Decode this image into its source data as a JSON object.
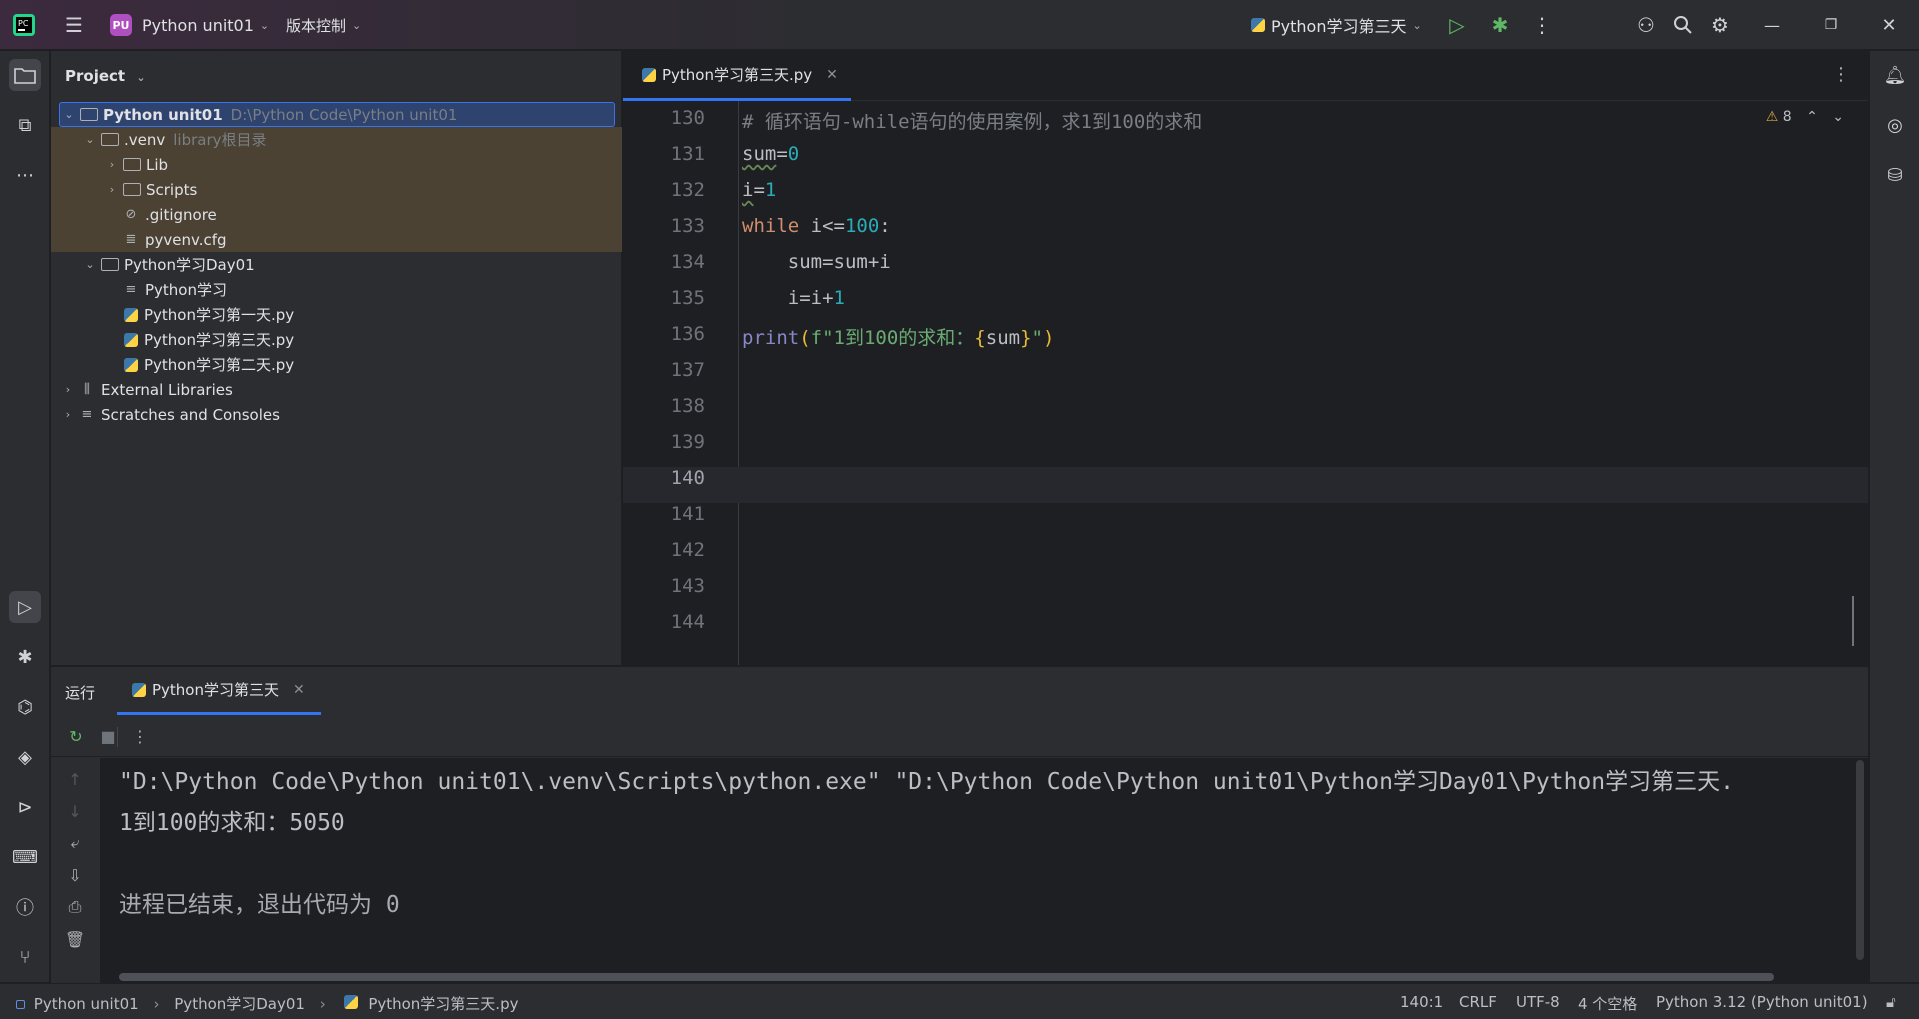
{
  "titlebar": {
    "project_badge": "PU",
    "project_name": "Python unit01",
    "vcs_label": "版本控制",
    "run_config": "Python学习第三天"
  },
  "project_panel": {
    "title": "Project",
    "tree": [
      {
        "label": "Python unit01",
        "hint": "D:\\Python Code\\Python unit01"
      },
      {
        "label": ".venv",
        "hint": "library根目录"
      },
      {
        "label": "Lib"
      },
      {
        "label": "Scripts"
      },
      {
        "label": ".gitignore"
      },
      {
        "label": "pyvenv.cfg"
      },
      {
        "label": "Python学习Day01"
      },
      {
        "label": "Python学习"
      },
      {
        "label": "Python学习第一天.py"
      },
      {
        "label": "Python学习第三天.py"
      },
      {
        "label": "Python学习第二天.py"
      },
      {
        "label": "External Libraries"
      },
      {
        "label": "Scratches and Consoles"
      }
    ]
  },
  "editor": {
    "tab_label": "Python学习第三天.py",
    "warnings_count": "8",
    "line_numbers": [
      "130",
      "131",
      "132",
      "133",
      "134",
      "135",
      "136",
      "137",
      "138",
      "139",
      "140",
      "141",
      "142",
      "143",
      "144"
    ],
    "code": {
      "l130": "# 循环语句-while语句的使用案例，求1到100的求和",
      "l131_a": "sum",
      "l131_b": "=",
      "l131_c": "0",
      "l132_a": "i",
      "l132_b": "=",
      "l132_c": "1",
      "l133_kw": "while",
      "l133_a": " i<=",
      "l133_num": "100",
      "l133_b": ":",
      "l134": "    sum=sum+i",
      "l135_a": "    i=i+",
      "l135_num": "1",
      "l136_fn": "print",
      "l136_a": "(",
      "l136_str1": "f\"1到100的求和：",
      "l136_br1": "{",
      "l136_var": "sum",
      "l136_br2": "}",
      "l136_str2": "\"",
      "l136_b": ")"
    }
  },
  "run_panel": {
    "label": "运行",
    "tab_label": "Python学习第三天",
    "output": [
      "\"D:\\Python Code\\Python unit01\\.venv\\Scripts\\python.exe\" \"D:\\Python Code\\Python unit01\\Python学习Day01\\Python学习第三天.",
      "1到100的求和：5050",
      "",
      "进程已结束，退出代码为 0"
    ]
  },
  "statusbar": {
    "breadcrumb": [
      "Python unit01",
      "Python学习Day01",
      "Python学习第三天.py"
    ],
    "position": "140:1",
    "line_sep": "CRLF",
    "encoding": "UTF-8",
    "indent": "4 个空格",
    "interpreter": "Python 3.12 (Python unit01)"
  },
  "colors": {
    "accent": "#3574f0",
    "keyword": "#cf8e6d",
    "number": "#2aacb8",
    "string": "#6aab73",
    "comment": "#7a7e85",
    "builtin": "#8888c6"
  }
}
